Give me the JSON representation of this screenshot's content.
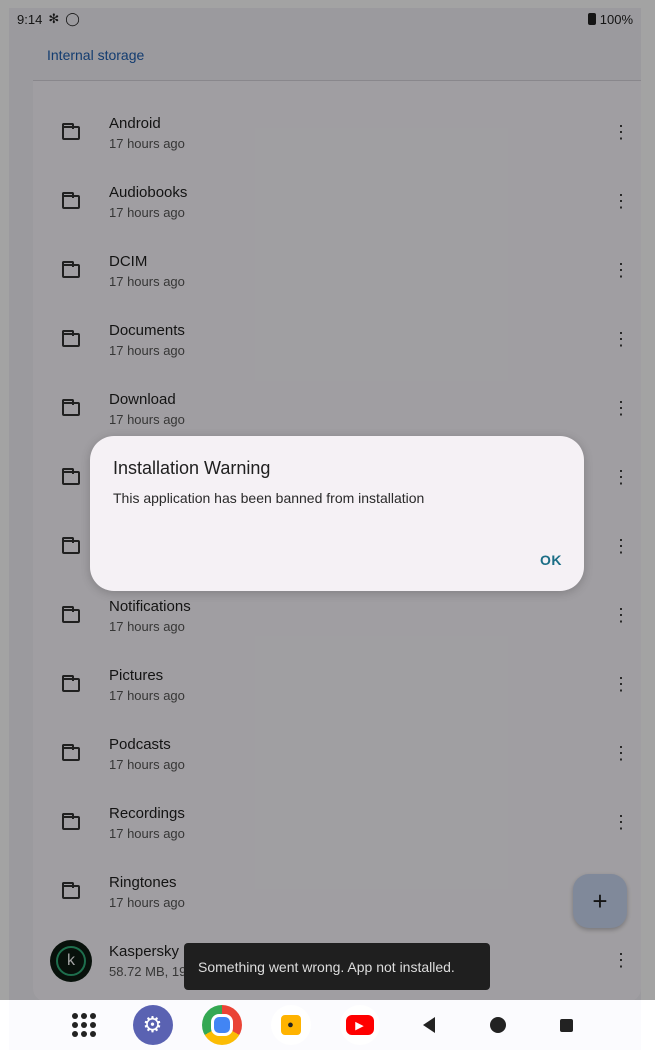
{
  "status": {
    "time": "9:14",
    "battery": "100%"
  },
  "header": {
    "title": "Internal storage"
  },
  "rows": [
    {
      "name": "Android",
      "sub": "17 hours ago"
    },
    {
      "name": "Audiobooks",
      "sub": "17 hours ago"
    },
    {
      "name": "DCIM",
      "sub": "17 hours ago"
    },
    {
      "name": "Documents",
      "sub": "17 hours ago"
    },
    {
      "name": "Download",
      "sub": "17 hours ago"
    },
    {
      "name": "",
      "sub": ""
    },
    {
      "name": "",
      "sub": ""
    },
    {
      "name": "Notifications",
      "sub": "17 hours ago"
    },
    {
      "name": "Pictures",
      "sub": "17 hours ago"
    },
    {
      "name": "Podcasts",
      "sub": "17 hours ago"
    },
    {
      "name": "Recordings",
      "sub": "17 hours ago"
    },
    {
      "name": "Ringtones",
      "sub": "17 hours ago"
    },
    {
      "name": "Kaspersky",
      "sub": "58.72 MB, 19"
    }
  ],
  "kaspersky_icon_letter": "k",
  "dialog": {
    "title": "Installation Warning",
    "message": "This application has been banned from installation",
    "ok": "OK"
  },
  "snackbar": {
    "text": "Something went wrong. App not installed."
  },
  "fab": {
    "label": "+"
  },
  "nav": {
    "settings_icon": "gear-icon",
    "chrome_icon": "chrome-icon",
    "youtube_icon": "youtube-icon"
  }
}
